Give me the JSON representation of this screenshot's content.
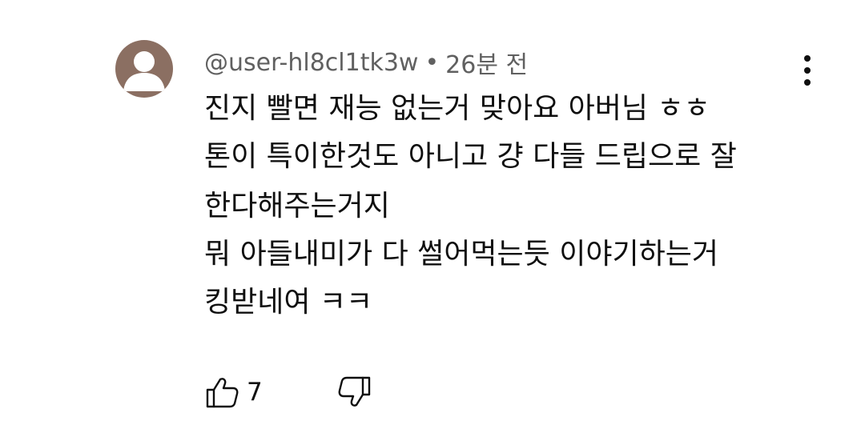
{
  "comment": {
    "author": "@user-hl8cl1tk3w",
    "separator": "•",
    "time": "26분 전",
    "lines": [
      "진지 빨면 재능 없는거 맞아요 아버님 ㅎㅎ",
      "톤이 특이한것도 아니고 걍 다들 드립으로 잘",
      "한다해주는거지",
      "뭐 아들내미가 다 썰어먹는듯 이야기하는거",
      "킹받네여 ㅋㅋ"
    ],
    "like_count": "7"
  },
  "icons": {
    "avatar": "default-user-avatar",
    "more": "more-vertical-icon",
    "like": "thumbs-up-icon",
    "dislike": "thumbs-down-icon"
  },
  "colors": {
    "avatar_bg": "#8b6f62",
    "meta_text": "#606060",
    "primary_text": "#0f0f0f"
  }
}
